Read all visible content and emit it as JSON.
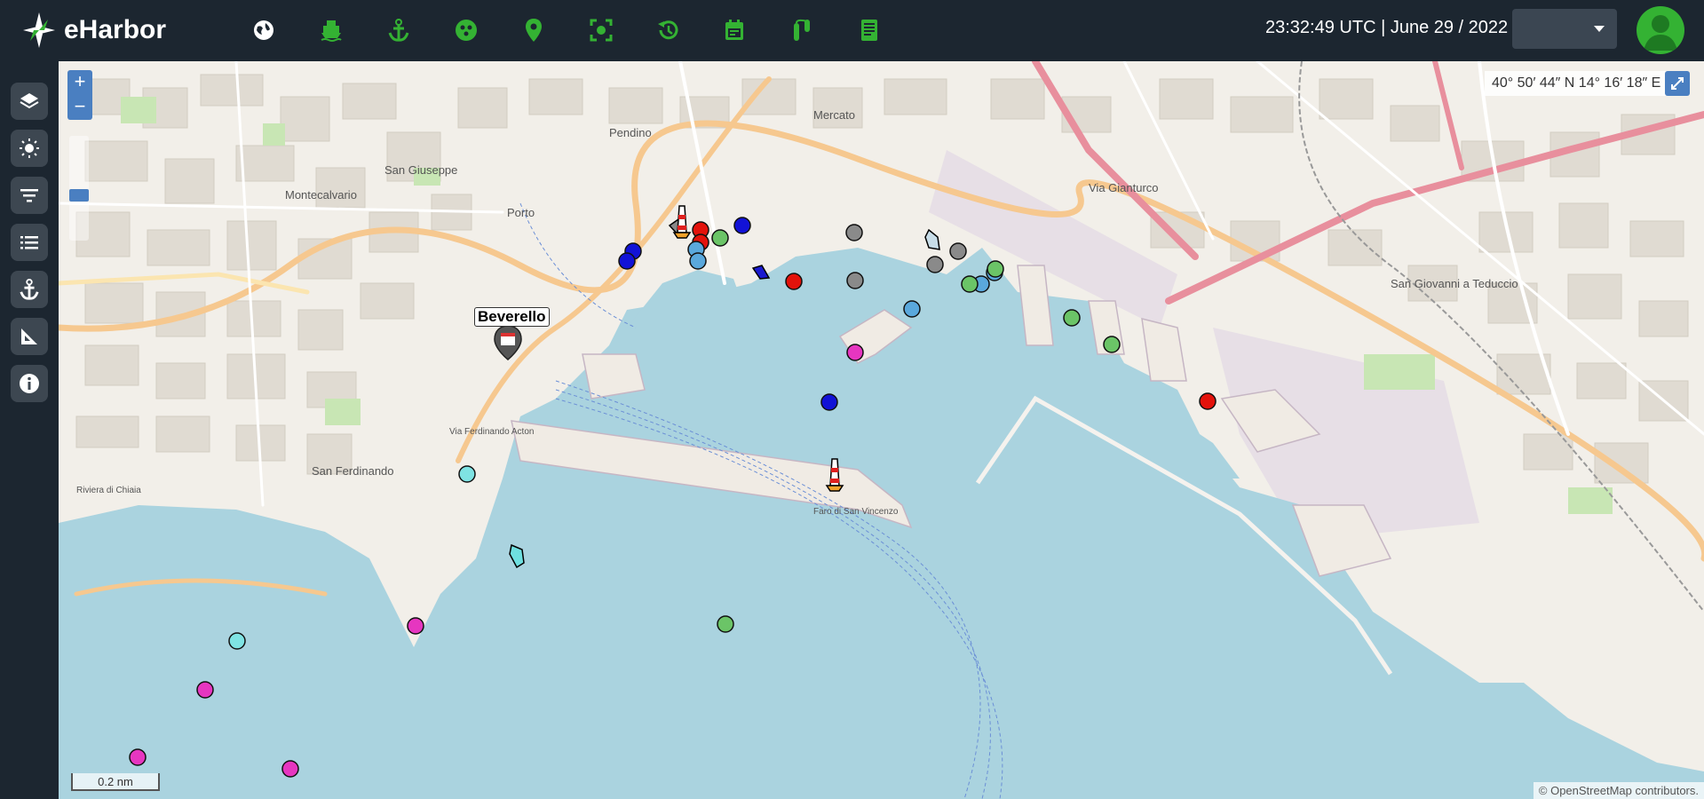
{
  "app": {
    "name": "eHarbor"
  },
  "header": {
    "clock": "23:32:49 UTC | June 29 / 2022",
    "nav_icons": [
      "globe-icon",
      "ship-icon",
      "anchor-icon",
      "sensor-icon",
      "pin-icon",
      "focus-icon",
      "history-icon",
      "calendar-icon",
      "route-icon",
      "report-icon"
    ],
    "select_value": ""
  },
  "sidebar": {
    "buttons": [
      "layers-icon",
      "weather-icon",
      "filter-icon",
      "list-icon",
      "anchor-icon",
      "measure-icon",
      "info-icon"
    ]
  },
  "map": {
    "coordinates": "40° 50′ 44″ N 14° 16′ 18″ E",
    "zoom_in": "+",
    "zoom_out": "−",
    "scale": "0.2 nm",
    "attribution": "© OpenStreetMap contributors.",
    "poi": {
      "label": "Beverello"
    },
    "labels": {
      "montecalvario": "Montecalvario",
      "san_giuseppe": "San Giuseppe",
      "porto": "Porto",
      "pendino": "Pendino",
      "mercato": "Mercato",
      "san_ferdinando": "San Ferdinando",
      "via_gianturco": "Via Gianturco",
      "san_giovanni": "San Giovanni a Teduccio",
      "faro": "Faro di San Vincenzo",
      "via_caracciolo": "Via Ferdinando Acton",
      "riviera": "Riviera di Chiaia"
    },
    "colors": {
      "water": "#aad3df",
      "land": "#f2efe9",
      "accent": "#34b233"
    }
  }
}
